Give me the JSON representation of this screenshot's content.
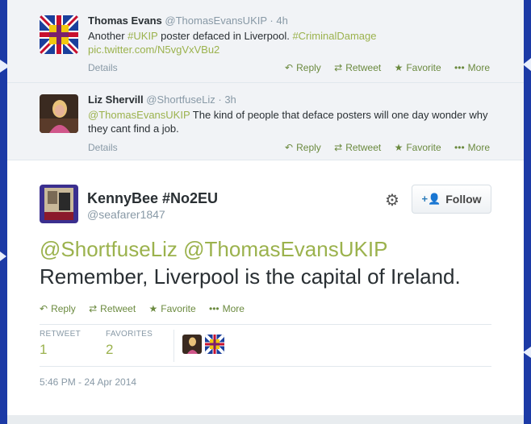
{
  "replies": [
    {
      "fullname": "Thomas Evans",
      "username": "@ThomasEvansUKIP",
      "dot": "·",
      "time": "4h",
      "text_1": "Another ",
      "hashtag_1": "#UKIP",
      "text_2": " poster defaced in Liverpool. ",
      "hashtag_2": "#CriminalDamage",
      "link": "pic.twitter.com/N5vgVxVBu2",
      "details": "Details",
      "avatar_icon": "union-jack-flag-avatar"
    },
    {
      "fullname": "Liz Shervill",
      "username": "@ShortfuseLiz",
      "dot": "·",
      "time": "3h",
      "mention": "@ThomasEvansUKIP",
      "text": " The kind of people that deface posters will one day wonder why they cant find a job.",
      "details": "Details",
      "avatar_icon": "person-photo-avatar"
    }
  ],
  "actions": {
    "reply": "Reply",
    "retweet": "Retweet",
    "favorite": "Favorite",
    "more": "More",
    "reply_icon": "reply-arrow-icon",
    "retweet_icon": "retweet-icon",
    "favorite_icon": "star-icon",
    "more_icon": "ellipsis-icon"
  },
  "main_tweet": {
    "fullname": "KennyBee #No2EU",
    "username": "@seafarer1847",
    "mention_1": "@ShortfuseLiz",
    "mention_2": "@ThomasEvansUKIP",
    "text": "Remember, Liverpool is the capital of Ireland.",
    "follow_label": "Follow",
    "retweet_label": "RETWEET",
    "retweet_count": "1",
    "favorites_label": "FAVORITES",
    "favorites_count": "2",
    "timestamp": "5:46 PM - 24 Apr 2014",
    "avatar_icon": "kennybee-avatar"
  },
  "colors": {
    "background": "#1c3aa6",
    "hashtag": "#9bb24d",
    "reply_bg": "#f1f3f6",
    "action": "#6b8a3f"
  }
}
